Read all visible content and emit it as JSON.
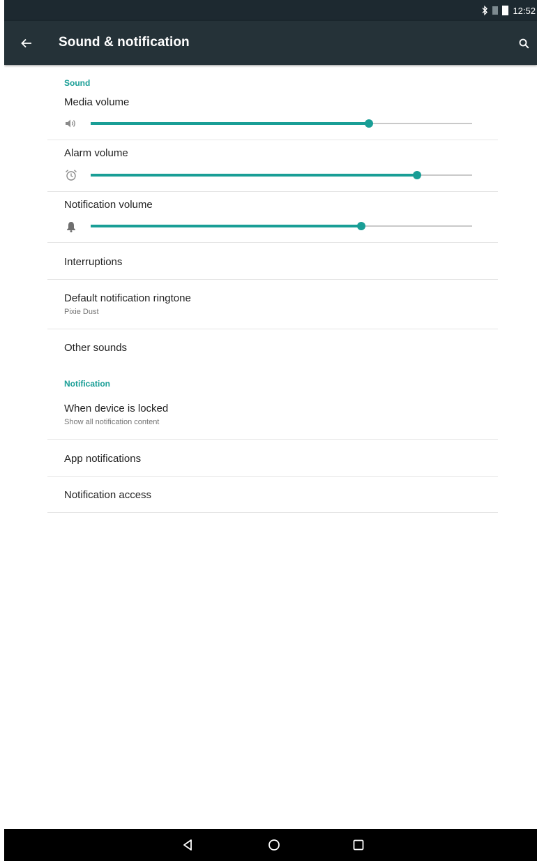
{
  "status_bar": {
    "time": "12:52",
    "icons": [
      "bluetooth-icon",
      "signal-icon",
      "battery-icon"
    ]
  },
  "app_bar": {
    "title": "Sound & notification",
    "back_icon": "arrow-back-icon",
    "search_icon": "search-icon"
  },
  "sound": {
    "header": "Sound",
    "media_volume": {
      "label": "Media volume",
      "icon": "speaker-icon",
      "level": 0.73
    },
    "alarm_volume": {
      "label": "Alarm volume",
      "icon": "alarm-clock-icon",
      "level": 0.855
    },
    "notification_volume": {
      "label": "Notification volume",
      "icon": "bell-icon",
      "level": 0.71
    },
    "interruptions": {
      "label": "Interruptions"
    },
    "ringtone": {
      "label": "Default notification ringtone",
      "summary": "Pixie Dust"
    },
    "other_sounds": {
      "label": "Other sounds"
    }
  },
  "notification": {
    "header": "Notification",
    "locked": {
      "label": "When device is locked",
      "summary": "Show all notification content"
    },
    "app_notifications": {
      "label": "App notifications"
    },
    "access": {
      "label": "Notification access"
    }
  },
  "nav_bar": {
    "icons": [
      "nav-back-icon",
      "nav-home-icon",
      "nav-recents-icon"
    ]
  },
  "colors": {
    "accent": "#199e96",
    "app_bar": "#253238",
    "status_bar": "#1d2930"
  }
}
